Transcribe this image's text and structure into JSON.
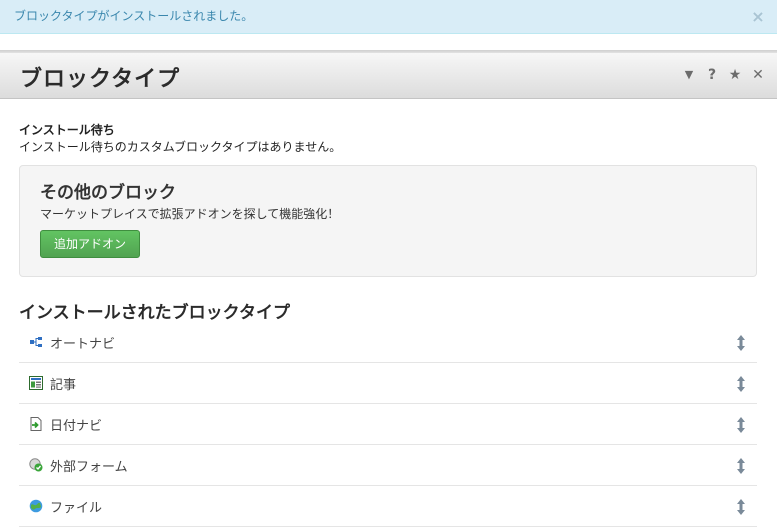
{
  "alert": {
    "message": "ブロックタイプがインストールされました。",
    "close": "×"
  },
  "panel": {
    "title": "ブロックタイプ",
    "tools": {
      "collapse": "▼",
      "help": "?",
      "favorite": "★",
      "close": "✕"
    }
  },
  "pending": {
    "title": "インストール待ち",
    "message": "インストール待ちのカスタムブロックタイプはありません。"
  },
  "marketplace": {
    "title": "その他のブロック",
    "description": "マーケットプレイスで拡張アドオンを探して機能強化！",
    "button_label": "追加アドオン"
  },
  "installed": {
    "title": "インストールされたブロックタイプ",
    "items": [
      {
        "label": "オートナビ",
        "icon": "sitemap-icon"
      },
      {
        "label": "記事",
        "icon": "content-icon"
      },
      {
        "label": "日付ナビ",
        "icon": "date-nav-icon"
      },
      {
        "label": "外部フォーム",
        "icon": "external-form-icon"
      },
      {
        "label": "ファイル",
        "icon": "file-icon"
      }
    ]
  },
  "colors": {
    "alert_bg": "#d9edf7",
    "alert_text": "#3a87ad",
    "button_green": "#5bb75b",
    "header_gradient_top": "#f7f7f7",
    "header_gradient_bottom": "#dcdcdc"
  }
}
